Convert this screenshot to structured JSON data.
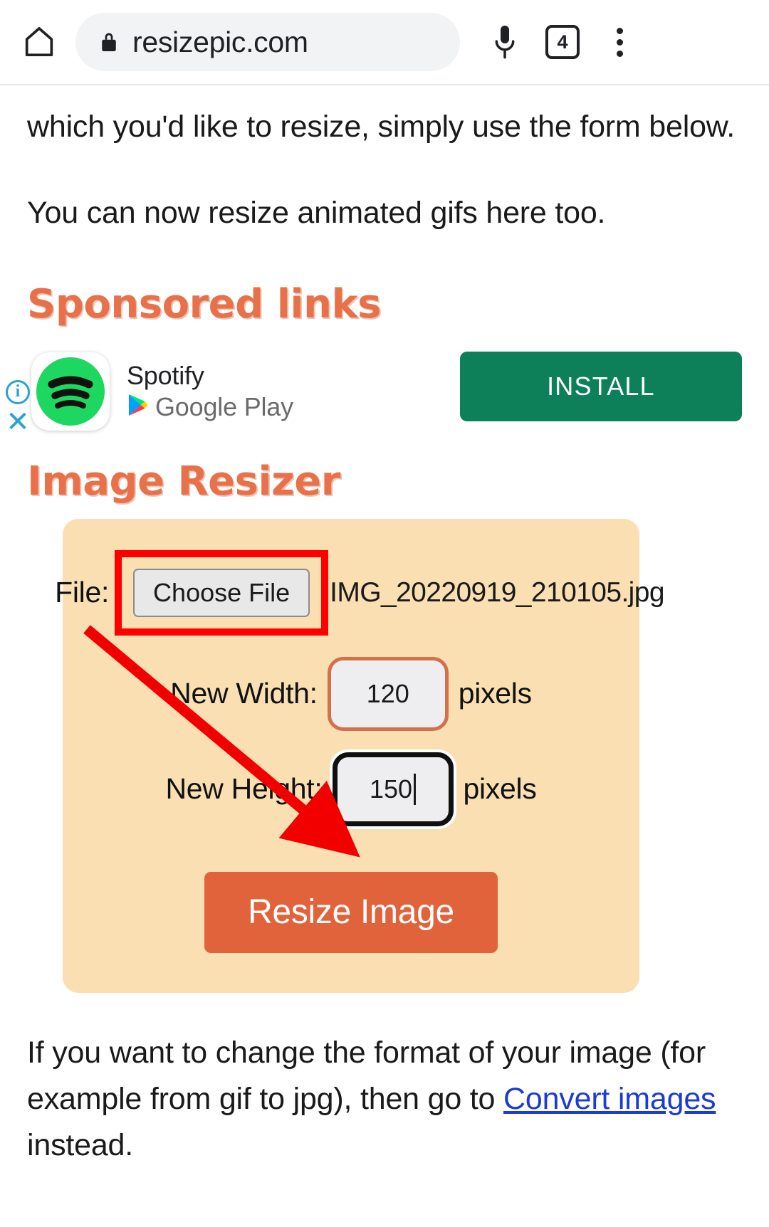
{
  "browser": {
    "home_icon": "home-icon",
    "lock_icon": "lock-icon",
    "url": "resizepic.com",
    "mic_icon": "microphone-icon",
    "tab_count": "4",
    "menu_icon": "three-dot-menu-icon"
  },
  "content": {
    "paragraph_intro": "which you'd like to resize, simply use the form below.",
    "paragraph_gifs": "You can now resize animated gifs here too.",
    "heading_sponsored": "Sponsored links",
    "heading_resizer": "Image Resizer"
  },
  "ad": {
    "info_icon": "info-icon",
    "info_glyph": "i",
    "close_icon": "close-icon",
    "close_glyph": "✕",
    "app_logo": "spotify-logo-icon",
    "app_name": "Spotify",
    "store_icon": "google-play-icon",
    "store_name": "Google Play",
    "install_label": "INSTALL",
    "install_color": "#0e8059"
  },
  "form": {
    "file_label": "File:",
    "choose_file_label": "Choose File",
    "file_name": "IMG_20220919_210105.jpg",
    "width_label": "New Width:",
    "width_value": "120",
    "width_unit": "pixels",
    "height_label": "New Height:",
    "height_value": "150",
    "height_unit": "pixels",
    "submit_label": "Resize Image",
    "panel_color": "#fadfb3",
    "submit_color": "#e0633c",
    "highlight_color": "#ff0000"
  },
  "footer": {
    "text_before": "If you want to change the format of your image (for example from gif to jpg), then go to ",
    "link_text": "Convert images",
    "text_after": " instead."
  }
}
